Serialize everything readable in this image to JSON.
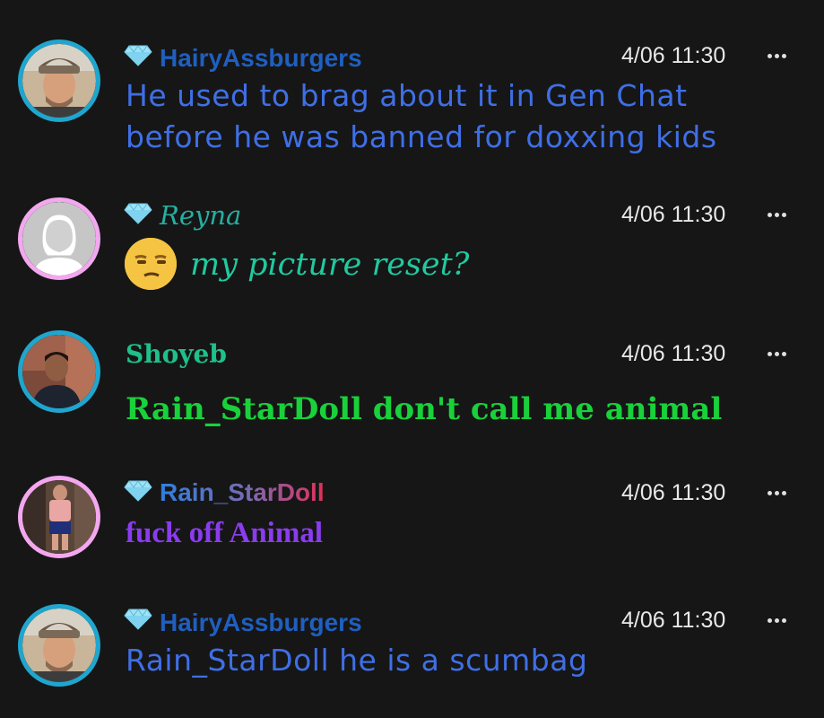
{
  "messages": [
    {
      "username": "HairyAssburgers",
      "timestamp": "4/06 11:30",
      "lines": [
        "He used to brag about it in Gen Chat",
        "before he was banned for doxxing kids"
      ],
      "name_color": "#1f5fbf",
      "text_color": "#3f6fe6"
    },
    {
      "username": "Reyna",
      "timestamp": "4/06 11:30",
      "lines": [
        "my picture reset?"
      ],
      "name_color": "#24b0a0",
      "text_color": "#21c9a0",
      "emoji": "unamused-face"
    },
    {
      "username": "Shoyeb",
      "timestamp": "4/06 11:30",
      "lines": [
        "Rain_StarDoll don't call me animal"
      ],
      "name_color": "#1fc08a",
      "text_color": "#19d13a"
    },
    {
      "username": "Rain_StarDoll",
      "timestamp": "4/06 11:30",
      "lines": [
        "fuck off Animal"
      ],
      "name_color": "#2f6fd8",
      "text_color": "#8a3cf0"
    },
    {
      "username": "HairyAssburgers",
      "timestamp": "4/06 11:30",
      "lines": [
        "Rain_StarDoll he is a scumbag"
      ],
      "name_color": "#1f5fbf",
      "text_color": "#3f6fe6"
    }
  ],
  "icons": {
    "badge": "diamond-gem-icon",
    "menu": "more-options-icon"
  }
}
